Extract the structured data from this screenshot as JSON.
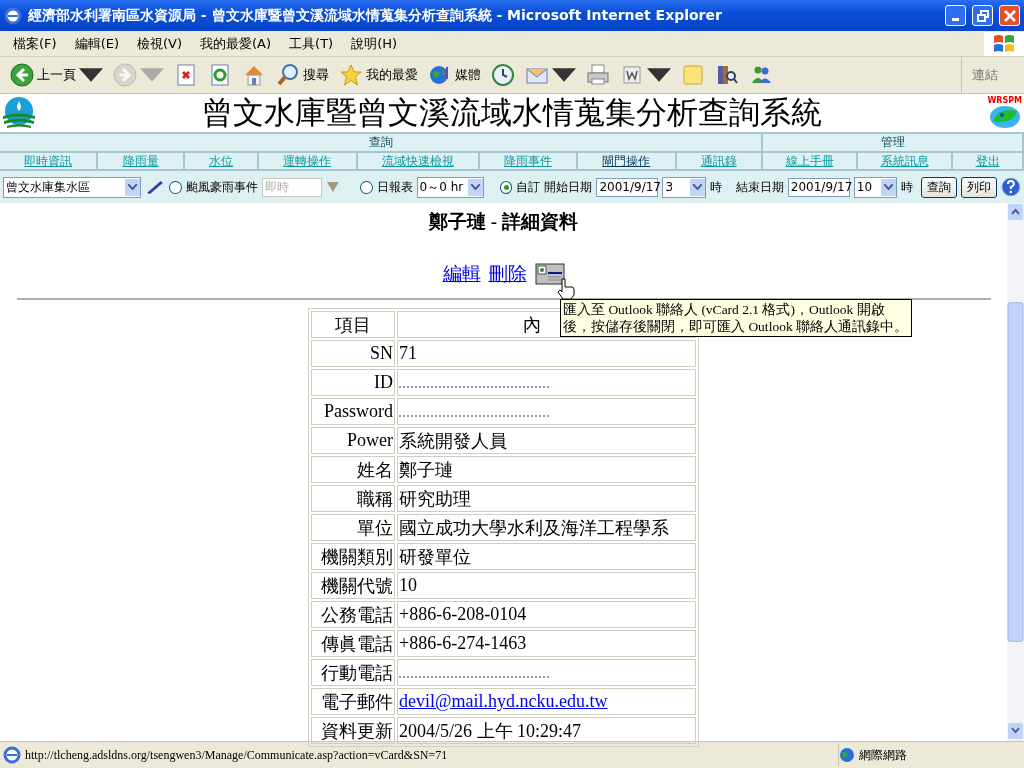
{
  "window": {
    "title": "經濟部水利署南區水資源局 - 曾文水庫暨曾文溪流域水情蒐集分析查詢系統 - Microsoft Internet Explorer"
  },
  "menu": [
    "檔案(F)",
    "編輯(E)",
    "檢視(V)",
    "我的最愛(A)",
    "工具(T)",
    "說明(H)"
  ],
  "toolbar": [
    {
      "kind": "back",
      "label": "上一頁",
      "dropdown": true
    },
    {
      "kind": "forward",
      "dropdown": true,
      "disabled": true
    },
    {
      "kind": "stop"
    },
    {
      "kind": "refresh"
    },
    {
      "kind": "home"
    },
    {
      "kind": "search",
      "label": "搜尋"
    },
    {
      "kind": "favorites",
      "label": "我的最愛"
    },
    {
      "kind": "media",
      "label": "媒體"
    },
    {
      "kind": "history"
    },
    {
      "kind": "mail",
      "dropdown": true
    },
    {
      "kind": "print"
    },
    {
      "kind": "edit",
      "dropdown": true
    },
    {
      "kind": "note"
    },
    {
      "kind": "research"
    },
    {
      "kind": "messenger"
    }
  ],
  "links_label": "連結",
  "header": {
    "title": "曾文水庫暨曾文溪流域水情蒐集分析查詢系統",
    "logo_caption": "WRSPM"
  },
  "nav": [
    {
      "label": "查詢",
      "links": [
        {
          "label": "即時資訊",
          "selected": false
        },
        {
          "label": "降雨量",
          "selected": false
        },
        {
          "label": "水位",
          "selected": false
        },
        {
          "label": "運轉操作",
          "selected": false
        },
        {
          "label": "流域快速檢視",
          "selected": false
        },
        {
          "label": "降雨事件",
          "selected": false
        },
        {
          "label": "閘門操作",
          "selected": true
        },
        {
          "label": "通訊錄",
          "selected": false
        }
      ]
    },
    {
      "label": "管理",
      "links": [
        {
          "label": "線上手冊",
          "selected": false
        },
        {
          "label": "系統訊息",
          "selected": false
        },
        {
          "label": "登出",
          "selected": false
        }
      ]
    }
  ],
  "controls": {
    "region": "曾文水庫集水區",
    "modes": [
      {
        "label": "颱風豪雨事件",
        "selected": false
      },
      {
        "label": "日報表",
        "selected": false
      },
      {
        "label": "自訂",
        "selected": true
      }
    ],
    "event_field": {
      "value": "即時",
      "disabled": true
    },
    "daily_select": "0～0 hr",
    "start_label": "開始日期",
    "start_date": "2001/9/17",
    "start_hour": "3",
    "hour_unit_1": "時",
    "end_label": "結束日期",
    "end_date": "2001/9/17",
    "end_hour": "10",
    "hour_unit_2": "時",
    "buttons": [
      "查詢",
      "列印"
    ]
  },
  "detail": {
    "heading": "鄭子璉 - 詳細資料",
    "actions": [
      "編輯",
      "刪除"
    ],
    "tooltip": "匯入至 Outlook 聯絡人 (vCard 2.1 格式)，Outlook 開啟後，按儲存後關閉，即可匯入 Outlook 聯絡人通訊錄中。",
    "columns": [
      "項目",
      "內"
    ],
    "rows": [
      {
        "label": "SN",
        "value": "71",
        "kind": "text"
      },
      {
        "label": "ID",
        "kind": "hidden"
      },
      {
        "label": "Password",
        "kind": "hidden"
      },
      {
        "label": "Power",
        "value": "系統開發人員",
        "kind": "text"
      },
      {
        "label": "姓名",
        "value": "鄭子璉",
        "kind": "text"
      },
      {
        "label": "職稱",
        "value": "研究助理",
        "kind": "text"
      },
      {
        "label": "單位",
        "value": "國立成功大學水利及海洋工程學系",
        "kind": "text"
      },
      {
        "label": "機關類別",
        "value": "研發單位",
        "kind": "text"
      },
      {
        "label": "機關代號",
        "value": "10",
        "kind": "text"
      },
      {
        "label": "公務電話",
        "value": "+886-6-208-0104",
        "kind": "text"
      },
      {
        "label": "傳眞電話",
        "value": "+886-6-274-1463",
        "kind": "text"
      },
      {
        "label": "行動電話",
        "kind": "hidden"
      },
      {
        "label": "電子郵件",
        "value": "devil@mail.hyd.ncku.edu.tw",
        "kind": "link"
      },
      {
        "label": "資料更新",
        "value": "2004/5/26 上午 10:29:47",
        "kind": "text"
      }
    ]
  },
  "status_bar": {
    "url": "http://tlcheng.adsldns.org/tsengwen3/Manage/Communicate.asp?action=vCard&SN=71",
    "zone": "網際網路"
  }
}
